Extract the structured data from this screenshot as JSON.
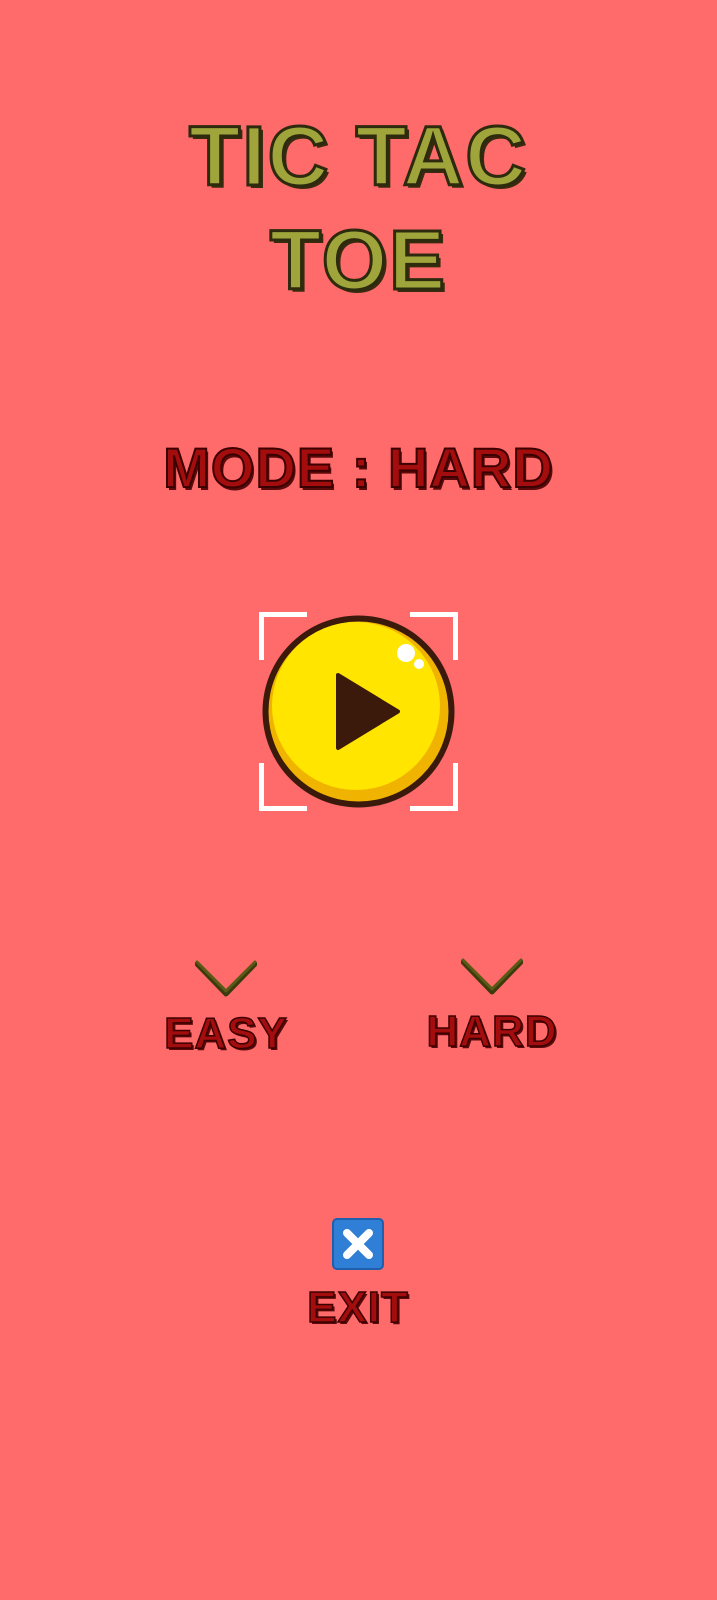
{
  "game": {
    "title_line1": "TIC TAC",
    "title_line2": "TOE"
  },
  "mode": {
    "label": "MODE : HARD"
  },
  "play_button": {
    "icon": "play-icon"
  },
  "difficulty_options": [
    {
      "label": "EASY",
      "icon": "chevron-down-icon"
    },
    {
      "label": "HARD",
      "icon": "chevron-down-icon"
    }
  ],
  "exit": {
    "label": "EXIT",
    "icon": "close-icon"
  },
  "colors": {
    "background": "#ff6b6b",
    "title": "#9fa53a",
    "label": "#a30d0d",
    "play_button": "#ffdd00",
    "exit_icon": "#2f7fd6"
  }
}
